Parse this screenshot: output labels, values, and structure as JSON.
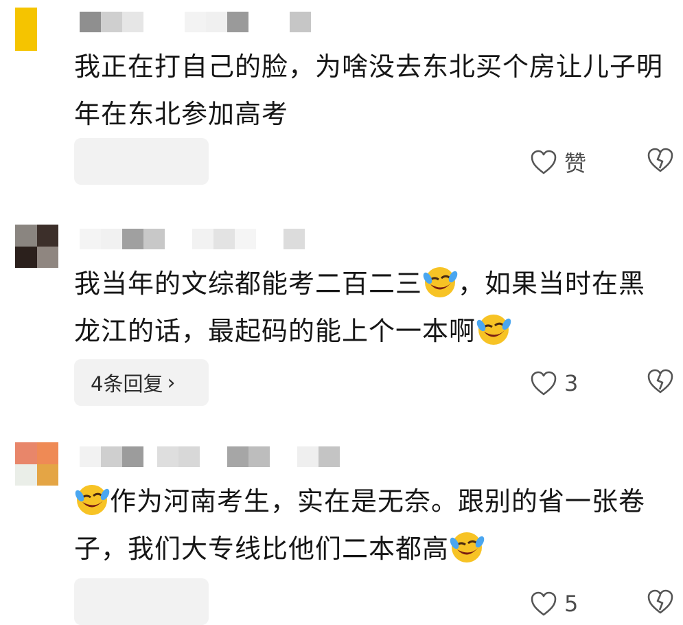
{
  "comments": [
    {
      "text": "我正在打自己的脸，为啥没去东北买个房让儿子明年在东北参加高考",
      "reply_label": "",
      "like_label": "赞",
      "avatar_colors": [
        "#f5c400",
        "#ffffff",
        "#f5c400",
        "#ffffff"
      ],
      "name_mosaic": [
        "#8f8f8f",
        "#cfcfcf",
        "#e6e6e6",
        "#ffffff",
        "#f3f3f3",
        "#f0f0f0",
        "#ffffff",
        "#9a9a9a",
        "#ffffff",
        "#c6c6c6"
      ]
    },
    {
      "text_parts": [
        "我当年的文综都能考二百二三",
        "，如果当时在黑龙江的话，最起码的能上个一本啊",
        ""
      ],
      "reply_label": "4条回复",
      "like_label": "3",
      "avatar_colors": [
        "#8a8580",
        "#3c2f2a",
        "#2b201c",
        "#8f8680"
      ],
      "name_mosaic": [
        "#f4f4f4",
        "#f1f1f1",
        "#a0a0a0",
        "#c8c8c8",
        "#ffffff",
        "#f2f2f2",
        "#e3e3e3",
        "#f5f5f5",
        "#ffffff",
        "#dcdcdc"
      ]
    },
    {
      "text_parts": [
        "",
        "作为河南考生，实在是无奈。跟别的省一张卷子，我们大专线比他们二本都高",
        ""
      ],
      "reply_label": "",
      "like_label": "5",
      "avatar_colors": [
        "#e8866a",
        "#ef8a55",
        "#eaeee8",
        "#e4a545"
      ],
      "name_mosaic": [
        "#f2f2f2",
        "#cfcfcf",
        "#9c9c9c",
        "#ffffff",
        "#dedede",
        "#d8d8d8",
        "#ffffff",
        "#a6a6a6",
        "#bdbdbd",
        "#efefef"
      ]
    }
  ],
  "icons": {
    "like": "heart-outline-icon",
    "dislike": "broken-heart-icon",
    "emoji": "laughing-crying-emoji"
  }
}
